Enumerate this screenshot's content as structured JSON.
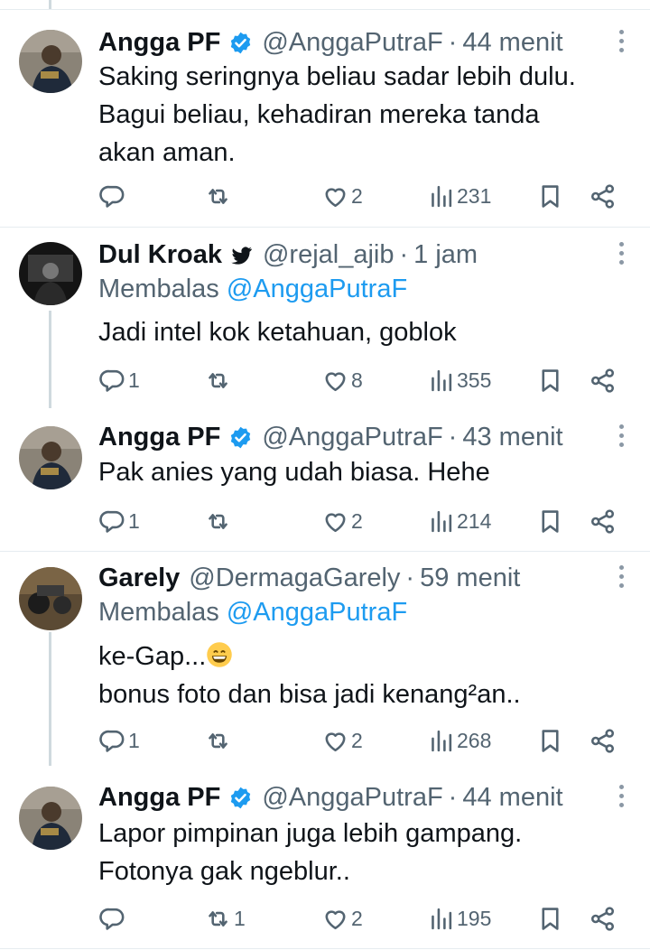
{
  "replies": [
    {
      "name": "Angga PF",
      "verified": true,
      "handle": "@AnggaPutraF",
      "time": "44 menit",
      "reply_label": "",
      "reply_mention": "",
      "lines": [
        "Saking seringnya beliau sadar lebih dulu.",
        "Bagui beliau, kehadiran mereka tanda",
        "akan aman."
      ],
      "stats": {
        "replies": "",
        "retweets": "",
        "likes": "2",
        "views": "231"
      }
    },
    {
      "name": "Dul Kroak",
      "verified": false,
      "handle": "@rejal_ajib",
      "time": "1 jam",
      "reply_label": "Membalas",
      "reply_mention": "@AnggaPutraF",
      "lines": [
        "Jadi intel kok ketahuan, goblok"
      ],
      "stats": {
        "replies": "1",
        "retweets": "",
        "likes": "8",
        "views": "355"
      }
    },
    {
      "name": "Angga PF",
      "verified": true,
      "handle": "@AnggaPutraF",
      "time": "43 menit",
      "reply_label": "",
      "reply_mention": "",
      "lines": [
        "Pak anies yang udah biasa. Hehe"
      ],
      "stats": {
        "replies": "1",
        "retweets": "",
        "likes": "2",
        "views": "214"
      }
    },
    {
      "name": "Garely",
      "verified": false,
      "handle": "@DermagaGarely",
      "time": "59 menit",
      "reply_label": "Membalas",
      "reply_mention": "@AnggaPutraF",
      "lines": [
        "ke-Gap...",
        "bonus foto dan bisa jadi kenang²an.."
      ],
      "stats": {
        "replies": "1",
        "retweets": "",
        "likes": "2",
        "views": "268"
      }
    },
    {
      "name": "Angga PF",
      "verified": true,
      "handle": "@AnggaPutraF",
      "time": "44 menit",
      "reply_label": "",
      "reply_mention": "",
      "lines": [
        "Lapor pimpinan juga lebih gampang.",
        "Fotonya gak ngeblur.."
      ],
      "stats": {
        "replies": "",
        "retweets": "1",
        "likes": "2",
        "views": "195"
      }
    }
  ],
  "icons": {
    "verified": "verified-badge-icon",
    "bird": "bird-icon",
    "reply": "reply-icon",
    "retweet": "retweet-icon",
    "like": "like-heart-icon",
    "views": "views-chart-icon",
    "bookmark": "bookmark-icon",
    "share": "share-icon",
    "more": "more-dots-icon",
    "emoji": "grinning-face-emoji"
  },
  "colors": {
    "link": "#1d9bf0",
    "muted": "#536471",
    "text": "#0f1419",
    "verified": "#1d9bf0"
  }
}
